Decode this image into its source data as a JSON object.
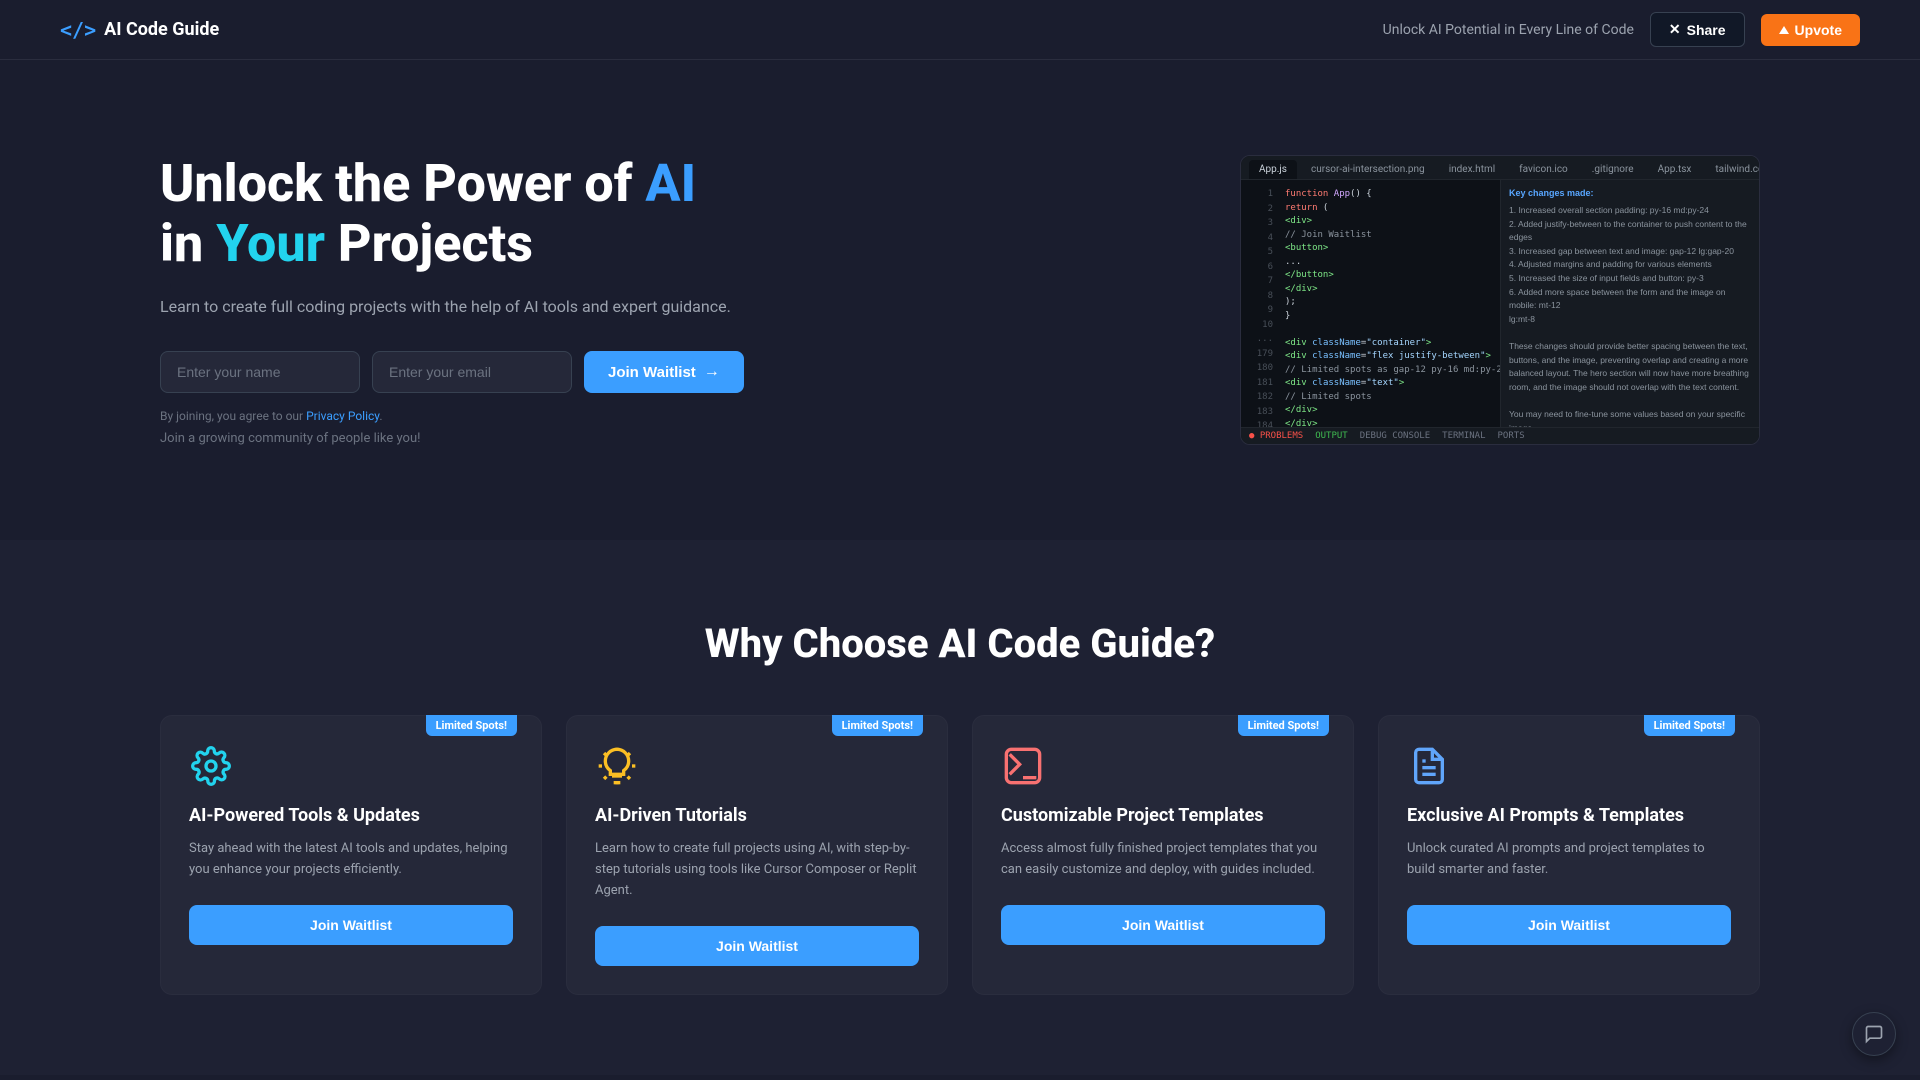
{
  "navbar": {
    "logo_brackets": "</>",
    "logo_text": "AI Code Guide",
    "tagline": "Unlock AI Potential in Every Line of Code",
    "share_label": "Share",
    "upvote_label": "Upvote"
  },
  "hero": {
    "title_line1_prefix": "Unlock the Power of ",
    "title_line1_highlight": "AI",
    "title_line2_prefix": "in ",
    "title_line2_highlight": "Your",
    "title_line2_suffix": " Projects",
    "subtitle": "Learn to create full coding projects with the help of AI tools and expert guidance.",
    "name_placeholder": "Enter your name",
    "email_placeholder": "Enter your email",
    "join_button": "Join Waitlist",
    "legal_text": "By joining, you agree to our ",
    "legal_link": "Privacy Policy",
    "legal_end": ".",
    "community_text": "Join a growing community of people like you!"
  },
  "editor": {
    "tabs": [
      "App.js",
      "cursor-ai-intersection.png",
      "index.html",
      "favicon.ico",
      ".gitignore",
      "App.tsx",
      "tailwind.config.js"
    ],
    "active_tab": "App.js",
    "status_bar": [
      "PROBLEMS",
      "OUTPUT",
      "DEBUG CONSOLE",
      "TERMINAL",
      "PORTS"
    ]
  },
  "why_section": {
    "title": "Why Choose AI Code Guide?",
    "cards": [
      {
        "badge": "Limited Spots!",
        "icon": "⚙",
        "icon_color": "teal",
        "title": "AI-Powered Tools & Updates",
        "desc": "Stay ahead with the latest AI tools and updates, helping you enhance your projects efficiently.",
        "button": "Join Waitlist"
      },
      {
        "badge": "Limited Spots!",
        "icon": "💡",
        "icon_color": "yellow",
        "title": "AI-Driven Tutorials",
        "desc": "Learn how to create full projects using AI, with step-by-step tutorials using tools like Cursor Composer or Replit Agent.",
        "button": "Join Waitlist"
      },
      {
        "badge": "Limited Spots!",
        "icon": "⌨",
        "icon_color": "red",
        "title": "Customizable Project Templates",
        "desc": "Access almost fully finished project templates that you can easily customize and deploy, with guides included.",
        "button": "Join Waitlist"
      },
      {
        "badge": "Limited Spots!",
        "icon": "📄",
        "icon_color": "blue",
        "title": "Exclusive AI Prompts & Templates",
        "desc": "Unlock curated AI prompts and project templates to build smarter and faster.",
        "button": "Join Waitlist"
      }
    ]
  }
}
